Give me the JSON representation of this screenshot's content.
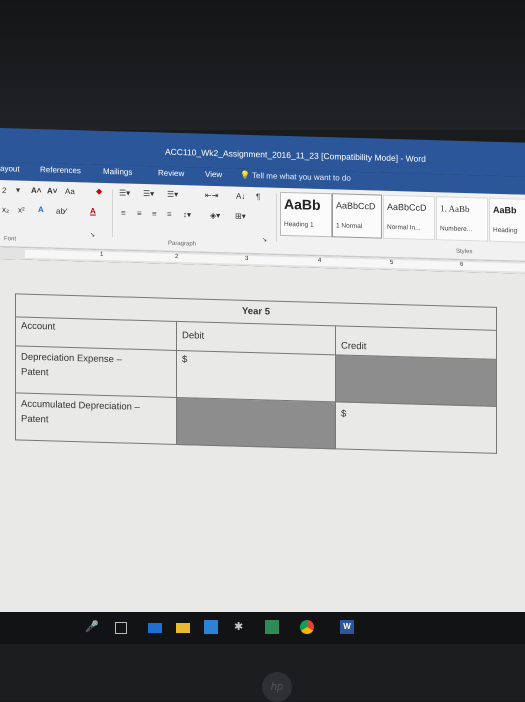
{
  "window": {
    "title": "ACC110_Wk2_Assignment_2016_11_23 [Compatibility Mode]  -  Word"
  },
  "tabs": [
    "ayout",
    "References",
    "Mailings",
    "Review",
    "View"
  ],
  "tell_me": "Tell me what you want to do",
  "ribbon": {
    "font_group": "Font",
    "paragraph_group": "Paragraph",
    "styles_group": "Styles",
    "font_size": "2",
    "aa_label": "Aa",
    "styles": [
      {
        "preview": "AaBb",
        "name": "Heading 1"
      },
      {
        "preview": "AaBbCcD",
        "name": "1 Normal"
      },
      {
        "preview": "AaBbCcD",
        "name": "Normal In..."
      },
      {
        "preview": "1. AaBb",
        "name": "Numbere..."
      },
      {
        "preview": "AaBb",
        "name": "Heading"
      }
    ]
  },
  "ruler": {
    "marks": [
      "1",
      "2",
      "3",
      "4",
      "5",
      "6"
    ]
  },
  "table": {
    "title": "Year 5",
    "headers": {
      "account": "Account",
      "debit": "Debit",
      "credit": "Credit"
    },
    "rows": [
      {
        "account_line1": "Depreciation Expense –",
        "account_line2": "Patent",
        "debit": "$",
        "credit": ""
      },
      {
        "account_line1": "Accumulated Depreciation –",
        "account_line2": "Patent",
        "debit": "",
        "credit": "$"
      }
    ]
  },
  "taskbar_icons": [
    "microphone-icon",
    "task-view-icon",
    "edge-icon",
    "file-explorer-icon",
    "store-icon",
    "puzzle-icon",
    "photos-icon",
    "chrome-icon",
    "word-icon"
  ],
  "colors": {
    "titlebar": "#2b579a",
    "shade": "#8d8d8d"
  }
}
